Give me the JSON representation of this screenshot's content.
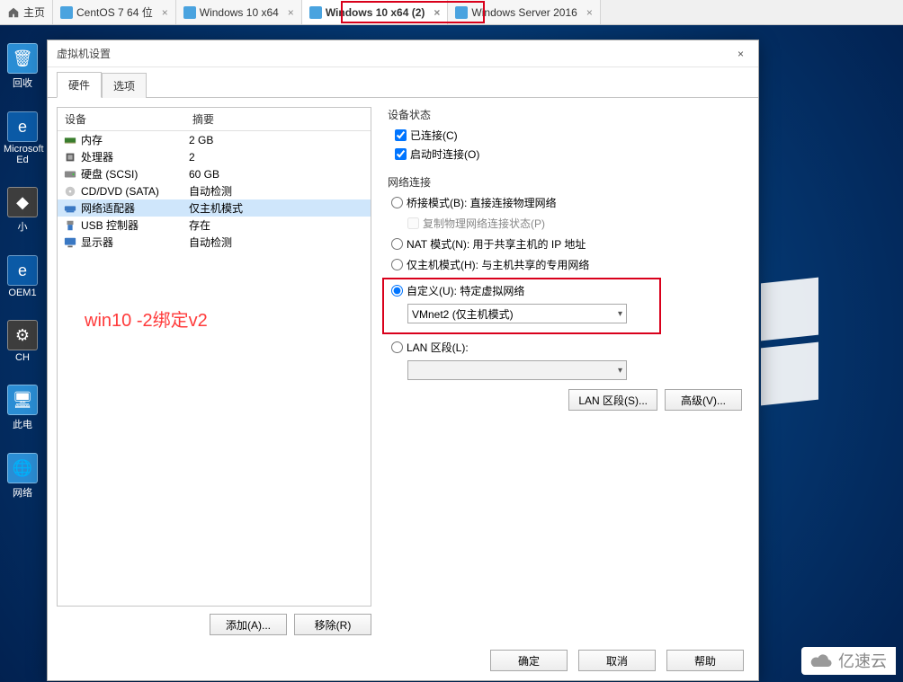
{
  "tabs": [
    {
      "label": "主页",
      "type": "home"
    },
    {
      "label": "CentOS 7 64 位",
      "type": "vm"
    },
    {
      "label": "Windows 10 x64",
      "type": "vm"
    },
    {
      "label": "Windows 10 x64 (2)",
      "type": "vm",
      "active": true
    },
    {
      "label": "Windows Server 2016",
      "type": "vm"
    }
  ],
  "close_glyph": "×",
  "dialog": {
    "title": "虚拟机设置",
    "tabs": {
      "hardware": "硬件",
      "options": "选项"
    },
    "headers": {
      "device": "设备",
      "summary": "摘要"
    },
    "devices": [
      {
        "icon": "memory-icon",
        "name": "内存",
        "summary": "2 GB"
      },
      {
        "icon": "cpu-icon",
        "name": "处理器",
        "summary": "2"
      },
      {
        "icon": "hdd-icon",
        "name": "硬盘 (SCSI)",
        "summary": "60 GB"
      },
      {
        "icon": "cd-icon",
        "name": "CD/DVD (SATA)",
        "summary": "自动检测"
      },
      {
        "icon": "network-icon",
        "name": "网络适配器",
        "summary": "仅主机模式",
        "selected": true
      },
      {
        "icon": "usb-icon",
        "name": "USB 控制器",
        "summary": "存在"
      },
      {
        "icon": "display-icon",
        "name": "显示器",
        "summary": "自动检测"
      }
    ],
    "annotation": "win10 -2绑定v2",
    "add_btn": "添加(A)...",
    "remove_btn": "移除(R)"
  },
  "right": {
    "state_title": "设备状态",
    "connected": "已连接(C)",
    "connect_poweron": "启动时连接(O)",
    "net_title": "网络连接",
    "bridged": "桥接模式(B): 直接连接物理网络",
    "replicate": "复制物理网络连接状态(P)",
    "nat": "NAT 模式(N): 用于共享主机的 IP 地址",
    "hostonly": "仅主机模式(H): 与主机共享的专用网络",
    "custom": "自定义(U): 特定虚拟网络",
    "custom_value": "VMnet2 (仅主机模式)",
    "lan": "LAN 区段(L):",
    "lan_btn": "LAN 区段(S)...",
    "adv_btn": "高级(V)..."
  },
  "footer": {
    "ok": "确定",
    "cancel": "取消",
    "help": "帮助"
  },
  "desktop_icons": [
    {
      "label": "回收",
      "glyph": "🗑"
    },
    {
      "label": "Microsoft Ed",
      "glyph": "e",
      "cls": "edge"
    },
    {
      "label": "小",
      "glyph": "◆",
      "cls": "dark"
    },
    {
      "label": "OEM1",
      "glyph": "e",
      "cls": "edge"
    },
    {
      "label": "CH",
      "glyph": "⚙",
      "cls": "dark"
    },
    {
      "label": "此电",
      "glyph": "🖥"
    },
    {
      "label": "网络",
      "glyph": "🌐"
    }
  ],
  "watermark": "亿速云"
}
